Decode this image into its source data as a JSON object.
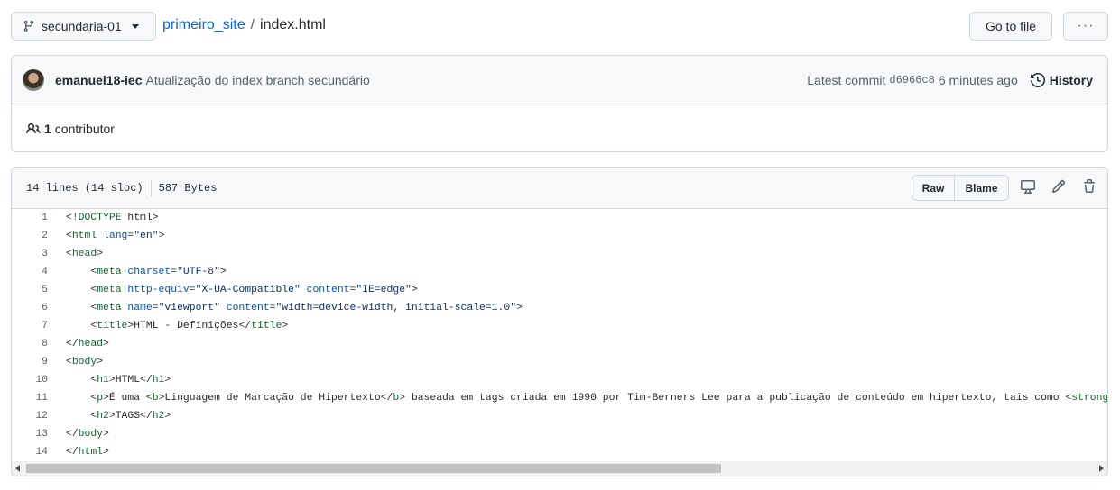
{
  "nav": {
    "branch": "secundaria-01",
    "repo": "primeiro_site",
    "separator": "/",
    "file": "index.html",
    "go_to_file": "Go to file",
    "more": "···"
  },
  "commit": {
    "author": "emanuel18-iec",
    "message": "Atualização do index branch secundário",
    "latest_label": "Latest commit",
    "sha": "d6966c8",
    "time": "6 minutes ago",
    "history_label": "History"
  },
  "contributors": {
    "count": "1",
    "label": "contributor"
  },
  "file": {
    "lines": "14 lines (14 sloc)",
    "size": "587 Bytes",
    "raw_label": "Raw",
    "blame_label": "Blame",
    "icons": [
      "desktop-icon",
      "pencil-icon",
      "trash-icon"
    ]
  },
  "code": [
    {
      "n": "1",
      "indent": "",
      "text": "<!DOCTYPE html>"
    },
    {
      "n": "2",
      "indent": "",
      "text": "<html lang=\"en\">"
    },
    {
      "n": "3",
      "indent": "",
      "text": "<head>"
    },
    {
      "n": "4",
      "indent": "    ",
      "text": "<meta charset=\"UTF-8\">"
    },
    {
      "n": "5",
      "indent": "    ",
      "text": "<meta http-equiv=\"X-UA-Compatible\" content=\"IE=edge\">"
    },
    {
      "n": "6",
      "indent": "    ",
      "text": "<meta name=\"viewport\" content=\"width=device-width, initial-scale=1.0\">"
    },
    {
      "n": "7",
      "indent": "    ",
      "text": "<title>HTML - Definições</title>"
    },
    {
      "n": "8",
      "indent": "",
      "text": "</head>"
    },
    {
      "n": "9",
      "indent": "",
      "text": "<body>"
    },
    {
      "n": "10",
      "indent": "    ",
      "text": "<h1>HTML</h1>"
    },
    {
      "n": "11",
      "indent": "    ",
      "text": "<p>É uma <b>Linguagem de Marcação de Hipertexto</b> baseada em tags criada em 1990 por Tim-Berners Lee para a publicação de conteúdo em hipertexto, tais como <strong>texto"
    },
    {
      "n": "12",
      "indent": "    ",
      "text": "<h2>TAGS</h2>"
    },
    {
      "n": "13",
      "indent": "",
      "text": "</body>"
    },
    {
      "n": "14",
      "indent": "",
      "text": "</html>"
    }
  ],
  "colors": {
    "link": "#0969da",
    "tag": "#116329",
    "attr": "#0550ae",
    "string": "#0a3069",
    "border": "#d0d7de",
    "header_bg": "#f6f8fa"
  }
}
